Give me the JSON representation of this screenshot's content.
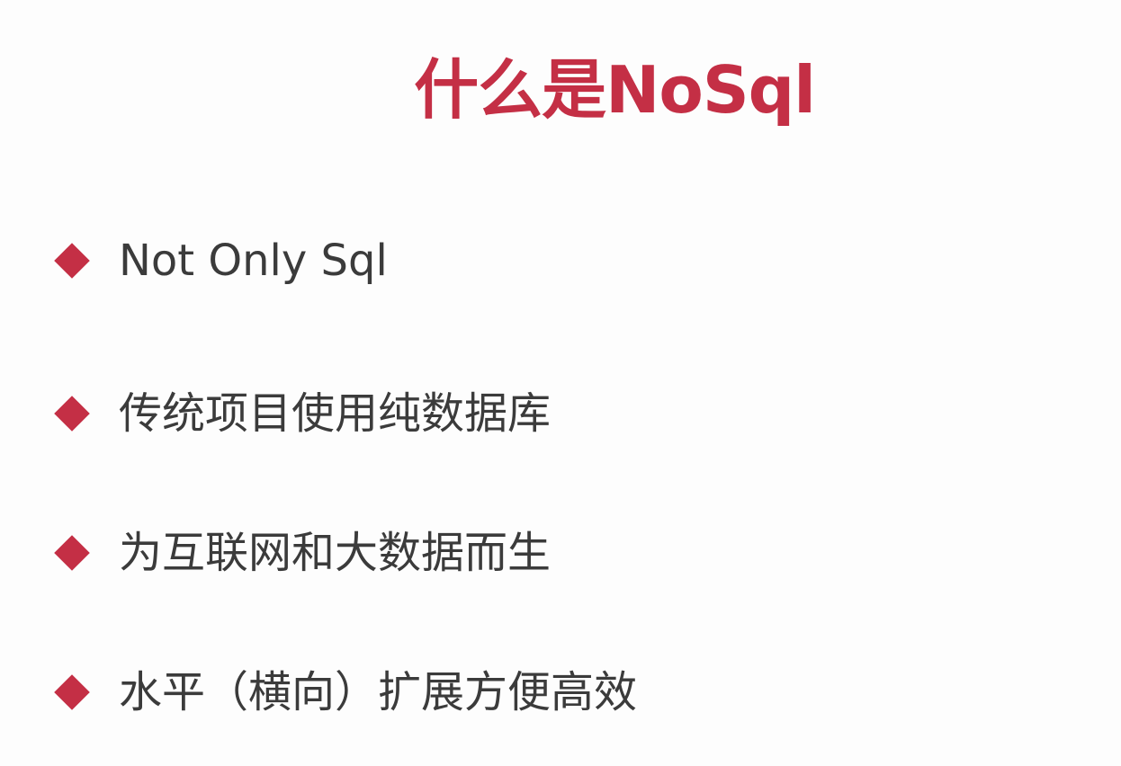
{
  "slide": {
    "title": "什么是NoSql",
    "bullets": [
      {
        "icon": "diamond-bullet-icon",
        "text": "Not Only Sql"
      },
      {
        "icon": "diamond-bullet-icon",
        "text": "传统项目使用纯数据库"
      },
      {
        "icon": "diamond-bullet-icon",
        "text": "为互联网和大数据而生"
      },
      {
        "icon": "diamond-bullet-icon",
        "text": "水平（横向）扩展方便高效"
      }
    ]
  },
  "colors": {
    "accent": "#c42f45",
    "text": "#3b3b3b",
    "background": "#fdfdfd"
  }
}
